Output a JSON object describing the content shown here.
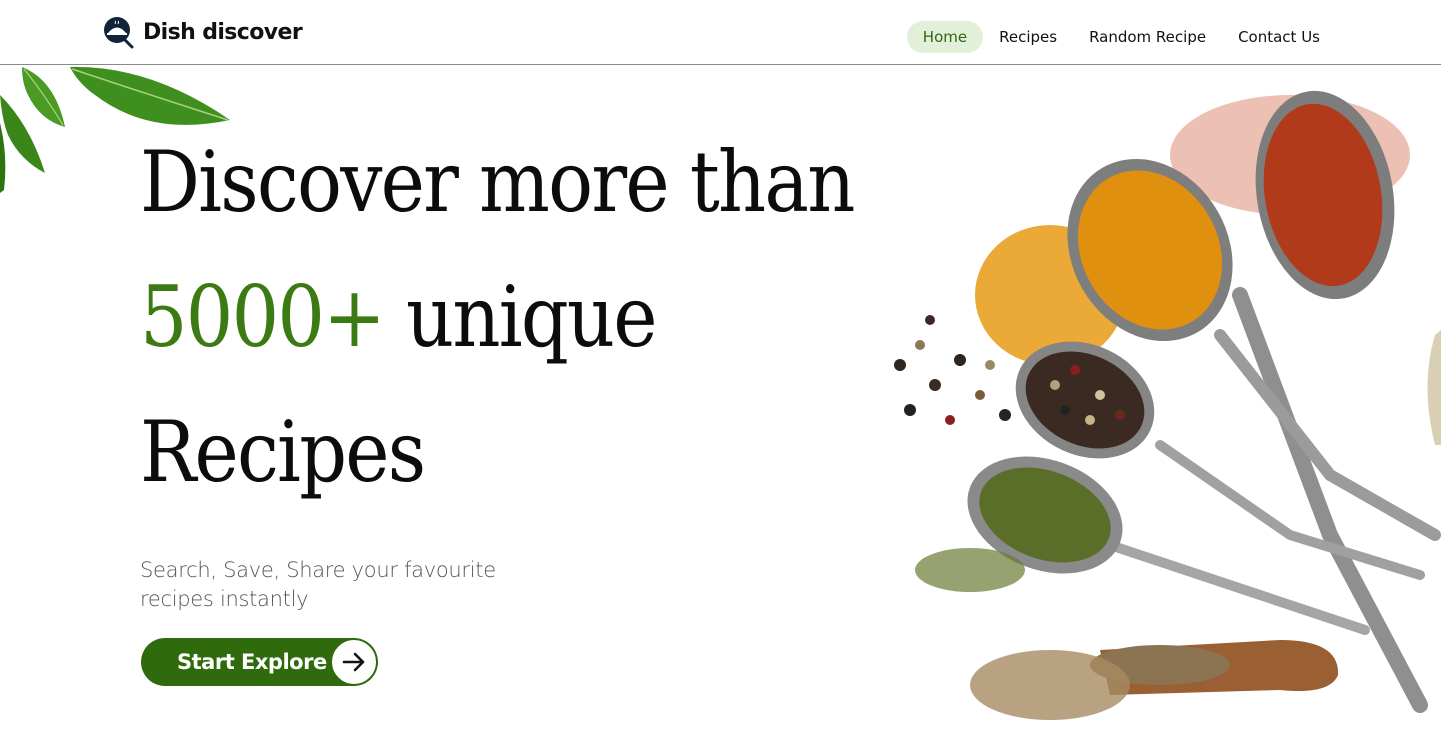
{
  "brand": {
    "name": "Dish discover",
    "logo_icon": "cloche-search-icon"
  },
  "nav": {
    "items": [
      {
        "label": "Home",
        "active": true
      },
      {
        "label": "Recipes",
        "active": false
      },
      {
        "label": "Random Recipe",
        "active": false
      },
      {
        "label": "Contact Us",
        "active": false
      }
    ]
  },
  "hero": {
    "line1": "Discover more than",
    "count": "5000+",
    "line2_rest": " unique",
    "line3": "Recipes",
    "subtitle": "Search, Save, Share your favourite recipes instantly",
    "cta_label": "Start Explore",
    "cta_icon": "arrow-right-icon"
  },
  "colors": {
    "accent": "#3c7a14",
    "button": "#2f6b0c",
    "nav_active_bg": "#e3f0d9",
    "divider": "#8a8a8a"
  }
}
